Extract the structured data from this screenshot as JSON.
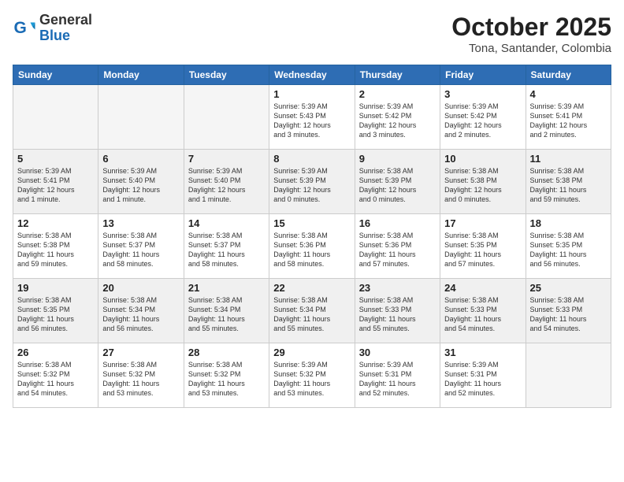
{
  "header": {
    "logo_general": "General",
    "logo_blue": "Blue",
    "month_title": "October 2025",
    "location": "Tona, Santander, Colombia"
  },
  "weekdays": [
    "Sunday",
    "Monday",
    "Tuesday",
    "Wednesday",
    "Thursday",
    "Friday",
    "Saturday"
  ],
  "weeks": [
    {
      "shade": false,
      "days": [
        {
          "num": "",
          "info": ""
        },
        {
          "num": "",
          "info": ""
        },
        {
          "num": "",
          "info": ""
        },
        {
          "num": "1",
          "info": "Sunrise: 5:39 AM\nSunset: 5:43 PM\nDaylight: 12 hours\nand 3 minutes."
        },
        {
          "num": "2",
          "info": "Sunrise: 5:39 AM\nSunset: 5:42 PM\nDaylight: 12 hours\nand 3 minutes."
        },
        {
          "num": "3",
          "info": "Sunrise: 5:39 AM\nSunset: 5:42 PM\nDaylight: 12 hours\nand 2 minutes."
        },
        {
          "num": "4",
          "info": "Sunrise: 5:39 AM\nSunset: 5:41 PM\nDaylight: 12 hours\nand 2 minutes."
        }
      ]
    },
    {
      "shade": true,
      "days": [
        {
          "num": "5",
          "info": "Sunrise: 5:39 AM\nSunset: 5:41 PM\nDaylight: 12 hours\nand 1 minute."
        },
        {
          "num": "6",
          "info": "Sunrise: 5:39 AM\nSunset: 5:40 PM\nDaylight: 12 hours\nand 1 minute."
        },
        {
          "num": "7",
          "info": "Sunrise: 5:39 AM\nSunset: 5:40 PM\nDaylight: 12 hours\nand 1 minute."
        },
        {
          "num": "8",
          "info": "Sunrise: 5:39 AM\nSunset: 5:39 PM\nDaylight: 12 hours\nand 0 minutes."
        },
        {
          "num": "9",
          "info": "Sunrise: 5:38 AM\nSunset: 5:39 PM\nDaylight: 12 hours\nand 0 minutes."
        },
        {
          "num": "10",
          "info": "Sunrise: 5:38 AM\nSunset: 5:38 PM\nDaylight: 12 hours\nand 0 minutes."
        },
        {
          "num": "11",
          "info": "Sunrise: 5:38 AM\nSunset: 5:38 PM\nDaylight: 11 hours\nand 59 minutes."
        }
      ]
    },
    {
      "shade": false,
      "days": [
        {
          "num": "12",
          "info": "Sunrise: 5:38 AM\nSunset: 5:38 PM\nDaylight: 11 hours\nand 59 minutes."
        },
        {
          "num": "13",
          "info": "Sunrise: 5:38 AM\nSunset: 5:37 PM\nDaylight: 11 hours\nand 58 minutes."
        },
        {
          "num": "14",
          "info": "Sunrise: 5:38 AM\nSunset: 5:37 PM\nDaylight: 11 hours\nand 58 minutes."
        },
        {
          "num": "15",
          "info": "Sunrise: 5:38 AM\nSunset: 5:36 PM\nDaylight: 11 hours\nand 58 minutes."
        },
        {
          "num": "16",
          "info": "Sunrise: 5:38 AM\nSunset: 5:36 PM\nDaylight: 11 hours\nand 57 minutes."
        },
        {
          "num": "17",
          "info": "Sunrise: 5:38 AM\nSunset: 5:35 PM\nDaylight: 11 hours\nand 57 minutes."
        },
        {
          "num": "18",
          "info": "Sunrise: 5:38 AM\nSunset: 5:35 PM\nDaylight: 11 hours\nand 56 minutes."
        }
      ]
    },
    {
      "shade": true,
      "days": [
        {
          "num": "19",
          "info": "Sunrise: 5:38 AM\nSunset: 5:35 PM\nDaylight: 11 hours\nand 56 minutes."
        },
        {
          "num": "20",
          "info": "Sunrise: 5:38 AM\nSunset: 5:34 PM\nDaylight: 11 hours\nand 56 minutes."
        },
        {
          "num": "21",
          "info": "Sunrise: 5:38 AM\nSunset: 5:34 PM\nDaylight: 11 hours\nand 55 minutes."
        },
        {
          "num": "22",
          "info": "Sunrise: 5:38 AM\nSunset: 5:34 PM\nDaylight: 11 hours\nand 55 minutes."
        },
        {
          "num": "23",
          "info": "Sunrise: 5:38 AM\nSunset: 5:33 PM\nDaylight: 11 hours\nand 55 minutes."
        },
        {
          "num": "24",
          "info": "Sunrise: 5:38 AM\nSunset: 5:33 PM\nDaylight: 11 hours\nand 54 minutes."
        },
        {
          "num": "25",
          "info": "Sunrise: 5:38 AM\nSunset: 5:33 PM\nDaylight: 11 hours\nand 54 minutes."
        }
      ]
    },
    {
      "shade": false,
      "days": [
        {
          "num": "26",
          "info": "Sunrise: 5:38 AM\nSunset: 5:32 PM\nDaylight: 11 hours\nand 54 minutes."
        },
        {
          "num": "27",
          "info": "Sunrise: 5:38 AM\nSunset: 5:32 PM\nDaylight: 11 hours\nand 53 minutes."
        },
        {
          "num": "28",
          "info": "Sunrise: 5:38 AM\nSunset: 5:32 PM\nDaylight: 11 hours\nand 53 minutes."
        },
        {
          "num": "29",
          "info": "Sunrise: 5:39 AM\nSunset: 5:32 PM\nDaylight: 11 hours\nand 53 minutes."
        },
        {
          "num": "30",
          "info": "Sunrise: 5:39 AM\nSunset: 5:31 PM\nDaylight: 11 hours\nand 52 minutes."
        },
        {
          "num": "31",
          "info": "Sunrise: 5:39 AM\nSunset: 5:31 PM\nDaylight: 11 hours\nand 52 minutes."
        },
        {
          "num": "",
          "info": ""
        }
      ]
    }
  ]
}
